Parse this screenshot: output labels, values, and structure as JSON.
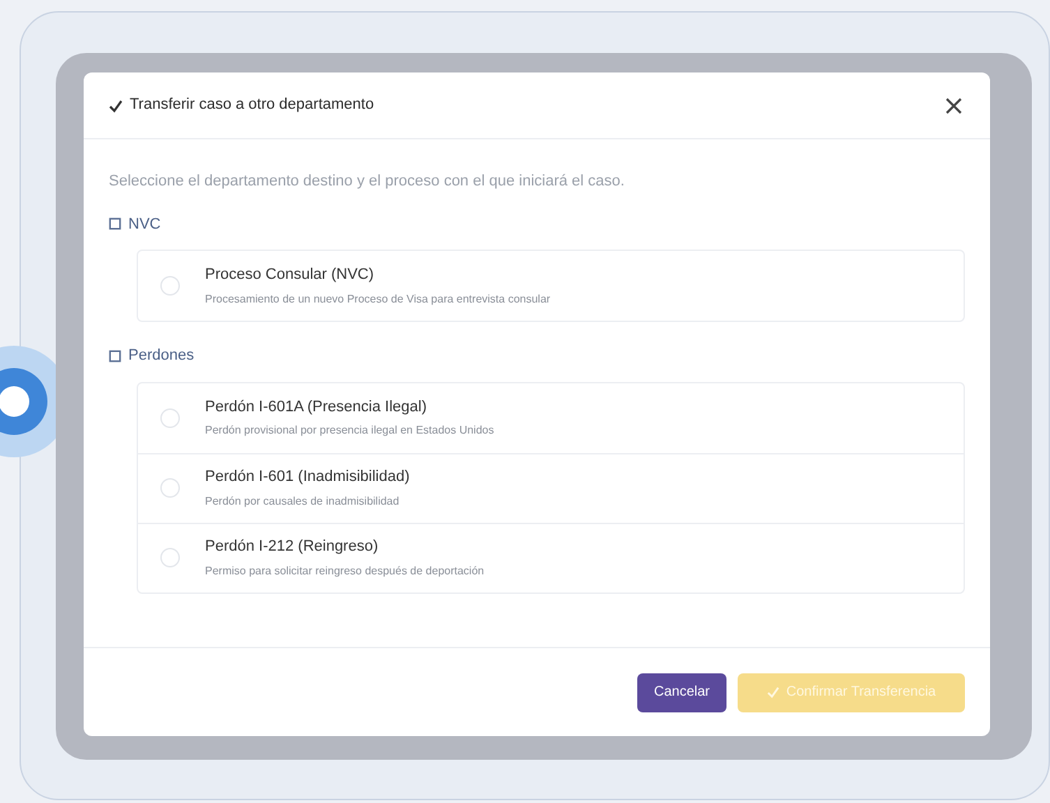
{
  "dialog": {
    "title": "Transferir caso a otro departamento",
    "instructions": "Seleccione el departamento destino y el proceso con el que iniciará el caso.",
    "groups": [
      {
        "name": "NVC",
        "options": [
          {
            "title": "Proceso Consular (NVC)",
            "description": "Procesamiento de un nuevo Proceso de Visa para entrevista consular",
            "selected": false
          }
        ]
      },
      {
        "name": "Perdones",
        "options": [
          {
            "title": "Perdón I-601A (Presencia Ilegal)",
            "description": "Perdón provisional por presencia ilegal en Estados Unidos",
            "selected": false
          },
          {
            "title": "Perdón I-601 (Inadmisibilidad)",
            "description": "Perdón por causales de inadmisibilidad",
            "selected": false
          },
          {
            "title": "Perdón I-212 (Reingreso)",
            "description": "Permiso para solicitar reingreso después de deportación",
            "selected": false
          }
        ]
      }
    ],
    "buttons": {
      "cancel": "Cancelar",
      "confirm": {
        "label": "Confirmar Transferencia",
        "disabled": true
      }
    }
  }
}
